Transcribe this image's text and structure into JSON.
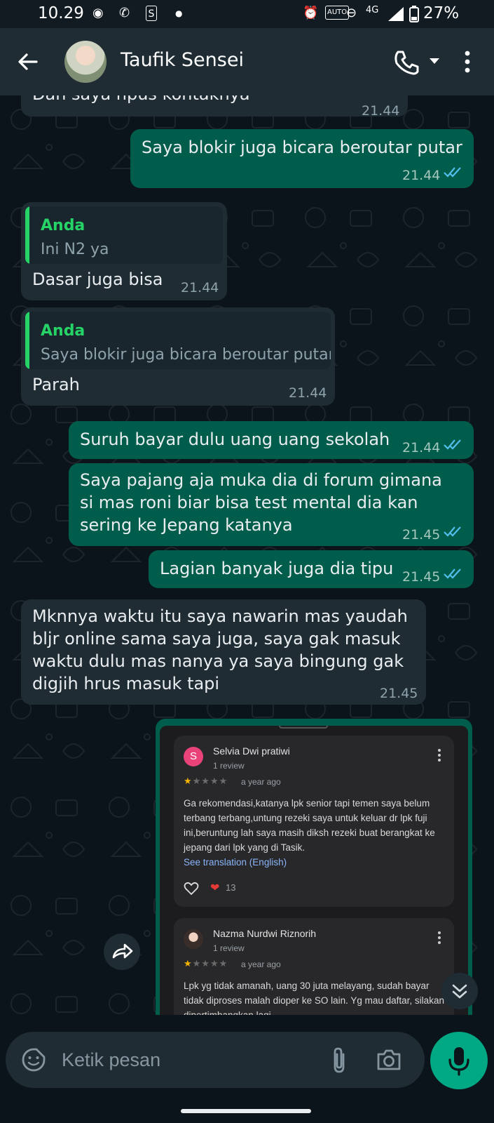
{
  "status_bar": {
    "time": "10.29",
    "network": "4G",
    "battery": "27%"
  },
  "header": {
    "contact_name": "Taufik Sensei"
  },
  "messages": [
    {
      "dir": "in",
      "text": "Dan saya hpus kontaknya",
      "time": "21.44"
    },
    {
      "dir": "out",
      "text": "Saya blokir juga bicara beroutar putar",
      "time": "21.44"
    },
    {
      "dir": "in",
      "quote_name": "Anda",
      "quote_text": "Ini N2 ya",
      "text": "Dasar juga bisa",
      "time": "21.44"
    },
    {
      "dir": "in",
      "quote_name": "Anda",
      "quote_text": "Saya blokir juga bicara beroutar putar",
      "text": "Parah",
      "time": "21.44"
    },
    {
      "dir": "out",
      "text": "Suruh bayar dulu uang  uang sekolah",
      "time": "21.44"
    },
    {
      "dir": "out",
      "lines": [
        "Saya pajang aja muka dia di forum gimana",
        "si mas roni biar bisa test mental dia kan",
        "sering ke Jepang katanya"
      ],
      "time": "21.45"
    },
    {
      "dir": "out",
      "text": "Lagian banyak juga dia tipu",
      "time": "21.45"
    },
    {
      "dir": "in",
      "lines": [
        "Mknnya waktu itu saya nawarin mas yaudah",
        "bljr online sama saya juga, saya gak masuk",
        "waktu dulu mas nanya ya saya bingung gak",
        "digjih hrus masuk tapi"
      ],
      "time": "21.45"
    }
  ],
  "image_message": {
    "reviews": [
      {
        "avatar_letter": "S",
        "name": "Selvia Dwi pratiwi",
        "count": "1 review",
        "stars": 1,
        "date": "a year ago",
        "text": "Ga rekomendasi,katanya lpk senior tapi temen saya belum terbang terbang,untung rezeki saya untuk keluar dr lpk fuji ini,beruntung lah saya masih diksh rezeki buat berangkat ke jepang dari lpk yang di Tasik.",
        "translation_link": "See translation (English)",
        "likes": "13"
      },
      {
        "name": "Nazma Nurdwi Riznorih",
        "count": "1 review",
        "stars": 1,
        "date": "a year ago",
        "text": "Lpk yg tidak amanah, uang 30 juta melayang, sudah bayar tidak diproses malah dioper ke SO lain. Yg mau daftar, silakan dipertimbangkan lagi."
      }
    ]
  },
  "composer": {
    "placeholder": "Ketik pesan"
  },
  "colors": {
    "incoming_bubble": "#1f2c34",
    "outgoing_bubble": "#005c4b",
    "accent": "#25d366",
    "read_ticks": "#53bdeb"
  }
}
